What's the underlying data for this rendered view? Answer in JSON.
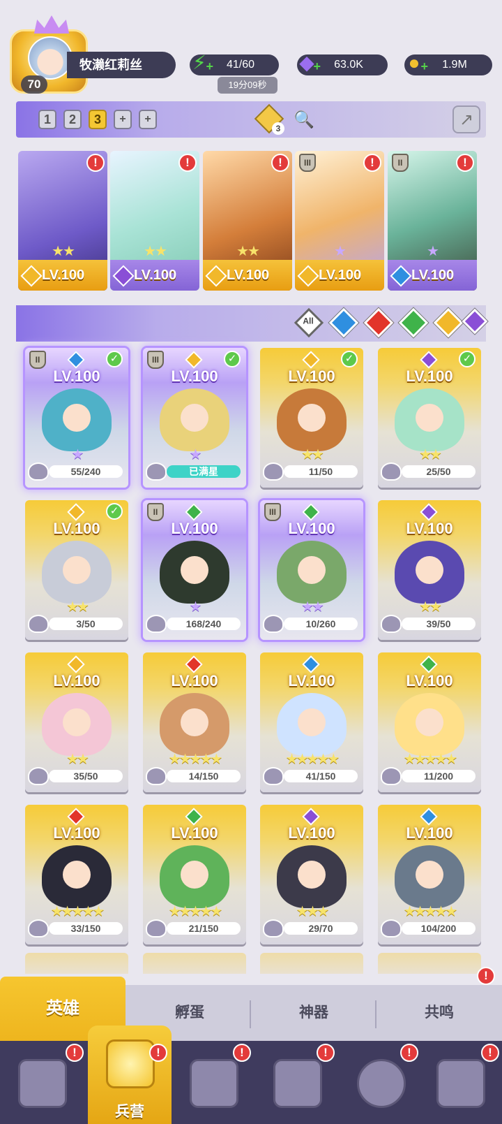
{
  "player": {
    "level": "70",
    "name": "牧濑红莉丝"
  },
  "resources": {
    "energy": "41/60",
    "energy_timer": "19分09秒",
    "gems": "63.0K",
    "gold": "1.9M"
  },
  "teams": {
    "tabs": [
      "1",
      "2",
      "3",
      "+",
      "+"
    ],
    "active_index": 2,
    "token_count": "3"
  },
  "team_cards": [
    {
      "level": "LV.100",
      "element": "sun",
      "stars": "★★",
      "alert": "!",
      "roman": ""
    },
    {
      "level": "LV.100",
      "element": "moon",
      "stars": "★★",
      "alert": "!",
      "roman": ""
    },
    {
      "level": "LV.100",
      "element": "sun",
      "stars": "★★",
      "alert": "!",
      "roman": ""
    },
    {
      "level": "LV.100",
      "element": "sun",
      "stars": "★",
      "alert": "!",
      "roman": "III"
    },
    {
      "level": "LV.100",
      "element": "water",
      "stars": "★",
      "alert": "!",
      "roman": "II"
    }
  ],
  "filters": {
    "all_label": "All",
    "elements": [
      "water",
      "fire",
      "wind",
      "sun",
      "moon"
    ]
  },
  "heroes": [
    {
      "level": "LV.100",
      "element": "water",
      "progress": "55/240",
      "stars": "★",
      "star_color": "purple",
      "check": true,
      "roman": "II",
      "frame": "purple"
    },
    {
      "level": "LV.100",
      "element": "sun",
      "progress": "已满星",
      "stars": "★",
      "star_color": "purple",
      "check": true,
      "roman": "III",
      "frame": "purple"
    },
    {
      "level": "LV.100",
      "element": "sun",
      "progress": "11/50",
      "stars": "★★",
      "star_color": "gold",
      "check": true,
      "roman": "",
      "frame": "gold"
    },
    {
      "level": "LV.100",
      "element": "moon",
      "progress": "25/50",
      "stars": "★★",
      "star_color": "gold",
      "check": true,
      "roman": "",
      "frame": "gold"
    },
    {
      "level": "LV.100",
      "element": "sun",
      "progress": "3/50",
      "stars": "★★",
      "star_color": "gold",
      "check": true,
      "roman": "",
      "frame": "gold"
    },
    {
      "level": "LV.100",
      "element": "wind",
      "progress": "168/240",
      "stars": "★",
      "star_color": "purple",
      "check": false,
      "roman": "II",
      "frame": "purple"
    },
    {
      "level": "LV.100",
      "element": "wind",
      "progress": "10/260",
      "stars": "★★",
      "star_color": "purple",
      "check": false,
      "roman": "III",
      "frame": "purple"
    },
    {
      "level": "LV.100",
      "element": "moon",
      "progress": "39/50",
      "stars": "★★",
      "star_color": "gold",
      "check": false,
      "roman": "",
      "frame": "gold"
    },
    {
      "level": "LV.100",
      "element": "sun",
      "progress": "35/50",
      "stars": "★★",
      "star_color": "gold",
      "check": false,
      "roman": "",
      "frame": "gold"
    },
    {
      "level": "LV.100",
      "element": "fire",
      "progress": "14/150",
      "stars": "★★★★★",
      "star_color": "gold",
      "check": false,
      "roman": "",
      "frame": "gold"
    },
    {
      "level": "LV.100",
      "element": "water",
      "progress": "41/150",
      "stars": "★★★★★",
      "star_color": "gold",
      "check": false,
      "roman": "",
      "frame": "gold"
    },
    {
      "level": "LV.100",
      "element": "wind",
      "progress": "11/200",
      "stars": "★★★★★",
      "star_color": "gold",
      "check": false,
      "roman": "",
      "frame": "gold"
    },
    {
      "level": "LV.100",
      "element": "fire",
      "progress": "33/150",
      "stars": "★★★★★",
      "star_color": "gold",
      "check": false,
      "roman": "",
      "frame": "gold"
    },
    {
      "level": "LV.100",
      "element": "wind",
      "progress": "21/150",
      "stars": "★★★★★",
      "star_color": "gold",
      "check": false,
      "roman": "",
      "frame": "gold"
    },
    {
      "level": "LV.100",
      "element": "moon",
      "progress": "29/70",
      "stars": "★★★",
      "star_color": "gold",
      "check": false,
      "roman": "",
      "frame": "gold"
    },
    {
      "level": "LV.100",
      "element": "water",
      "progress": "104/200",
      "stars": "★★★★★",
      "star_color": "gold",
      "check": false,
      "roman": "",
      "frame": "gold"
    }
  ],
  "subtabs": [
    "英雄",
    "孵蛋",
    "神器",
    "共鸣"
  ],
  "bottom_nav": {
    "active_label": "兵营",
    "alert": "!"
  },
  "colors": {
    "water": "#2f8fe0",
    "fire": "#e2352a",
    "wind": "#3fb34a",
    "sun": "#f1b82a",
    "moon": "#8a4fd6",
    "gold_card": "#f3c840",
    "purple_card": "#b89af0"
  }
}
